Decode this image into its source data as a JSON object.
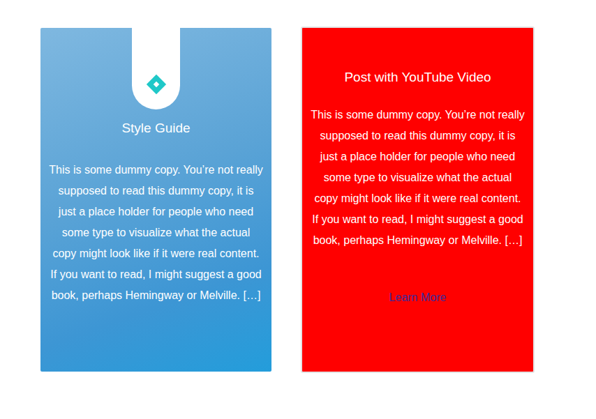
{
  "cards": [
    {
      "kind": "image",
      "title": "Style Guide",
      "excerpt": "This is some dummy copy. You’re not really supposed to read this dummy copy, it is just a place holder for people who need some type to visualize what the actual copy might look like if it were real content. If you want to read, I might suggest a good book, perhaps Hemingway or Melville. […]"
    },
    {
      "kind": "plain",
      "title": "Post with YouTube Video",
      "excerpt": "This is some dummy copy. You’re not really supposed to read this dummy copy, it is just a place holder for people who need some type to visualize what the actual copy might look like if it were real content. If you want to read, I might suggest a good book, perhaps Hemingway or Melville. […]",
      "link": "Learn More"
    }
  ]
}
